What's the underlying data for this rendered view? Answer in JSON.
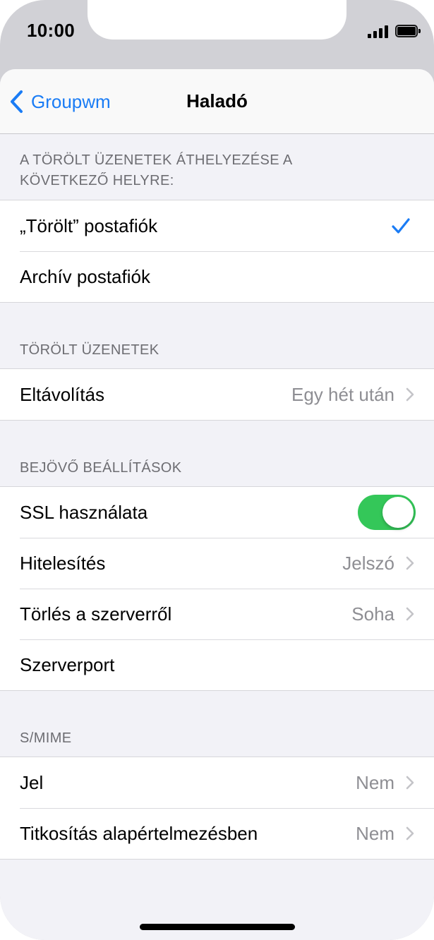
{
  "status_bar": {
    "time": "10:00"
  },
  "nav": {
    "back_label": "Groupwm",
    "title": "Haladó"
  },
  "sections": {
    "move_deleted": {
      "header_line1": "A TÖRÖLT ÜZENETEK ÁTHELYEZÉSE A",
      "header_line2": "KÖVETKEZŐ HELYRE:",
      "rows": [
        {
          "label": "„Törölt” postafiók",
          "selected": true
        },
        {
          "label": "Archív postafiók",
          "selected": false
        }
      ]
    },
    "deleted_messages": {
      "header": "TÖRÖLT ÜZENETEK",
      "rows": [
        {
          "label": "Eltávolítás",
          "value": "Egy hét után"
        }
      ]
    },
    "incoming": {
      "header": "BEJÖVŐ BEÁLLÍTÁSOK",
      "rows": [
        {
          "label": "SSL használata",
          "toggle_on": true
        },
        {
          "label": "Hitelesítés",
          "value": "Jelszó"
        },
        {
          "label": "Törlés a szerverről",
          "value": "Soha"
        },
        {
          "label": "Szerverport"
        }
      ]
    },
    "smime": {
      "header": "S/MIME",
      "rows": [
        {
          "label": "Jel",
          "value": "Nem"
        },
        {
          "label": "Titkosítás alapértelmezésben",
          "value": "Nem"
        }
      ]
    }
  },
  "colors": {
    "accent": "#1a7cf5",
    "toggle_on": "#34c759",
    "secondary_text": "#8e8e93"
  },
  "icons": [
    "chevron-left-icon",
    "checkmark-icon",
    "chevron-right-icon",
    "signal-icon",
    "battery-icon"
  ]
}
